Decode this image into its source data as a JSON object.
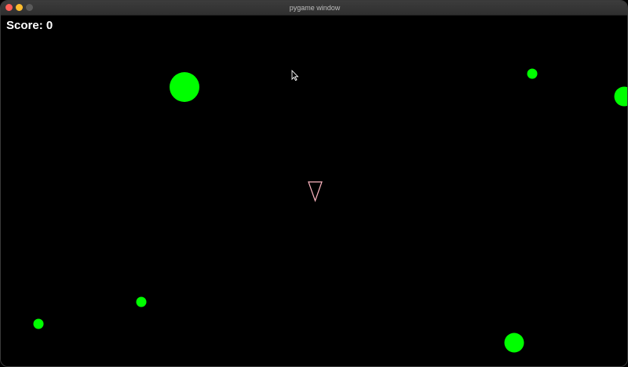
{
  "window": {
    "title": "pygame window"
  },
  "hud": {
    "score_label": "Score: 0"
  },
  "colors": {
    "background": "#000000",
    "asteroid": "#00ff00",
    "ship_outline": "#ffb6c1",
    "text": "#ffffff"
  },
  "icons": {
    "close": "close-icon",
    "minimize": "minimize-icon",
    "maximize": "maximize-icon",
    "cursor": "cursor-icon"
  }
}
